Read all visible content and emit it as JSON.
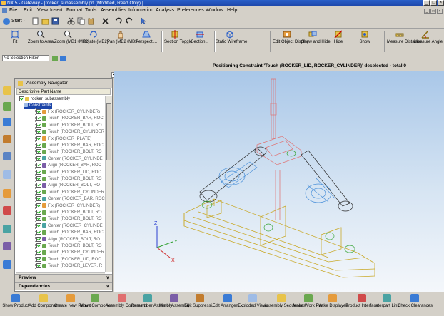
{
  "window": {
    "title": "NX 5 - Gateway - [rocker_subassembly.prt (Modified, Read Only) ]"
  },
  "menu": [
    "File",
    "Edit",
    "View",
    "Insert",
    "Format",
    "Tools",
    "Assemblies",
    "Information",
    "Analysis",
    "Preferences",
    "Window",
    "Help"
  ],
  "start_label": "Start ·",
  "toolbar": [
    "Fit",
    "Zoom to Area",
    "Zoom (MB1+MB2)",
    "Rotate (MB2)",
    "Pan (MB2+MB3)",
    "Perspecti...",
    "Section Toggle",
    "Section...",
    "Static Wireframe",
    "Edit Object Display",
    "Show and Hide",
    "Hide",
    "Show",
    "Measure Distance",
    "Measure Angle"
  ],
  "selection_filter": "No Selection Filter",
  "status_message": "Positioning Constraint 'Touch (ROCKER_LID, ROCKER_CYLINDER)' deselected - total 0",
  "navigator": {
    "title": "Assembly Navigator",
    "column": "Descriptive Part Name",
    "root": "rocker_subassembly",
    "constraints_folder": "Constraints",
    "items": [
      "Fix (ROCKER_CYLINDER)",
      "Touch (ROCKER_BAR, ROC",
      "Touch (ROCKER_BOLT, RO",
      "Touch (ROCKER_CYLINDER",
      "Fix (ROCKER_PLATE)",
      "Touch (ROCKER_BAR, ROC",
      "Touch (ROCKER_BOLT, RO",
      "Center (ROCKER_CYLINDE",
      "Align (ROCKER_BAR, ROC",
      "Touch (ROCKER_LID, ROC",
      "Touch (ROCKER_BOLT, RO",
      "Align (ROCKER_BOLT, RO",
      "Touch (ROCKER_CYLINDER",
      "Center (ROCKER_BAR, ROC",
      "Fix (ROCKER_CYLINDER)",
      "Touch (ROCKER_BOLT, RO",
      "Touch (ROCKER_BOLT, RO",
      "Center (ROCKER_CYLINDE",
      "Touch (ROCKER_BAR, ROC",
      "Align (ROCKER_BOLT, RO",
      "Touch (ROCKER_BOLT, RO",
      "Touch (ROCKER_CYLINDER",
      "Touch (ROCKER_LID, ROC",
      "Touch (ROCKER_LEVER, R"
    ],
    "panels": [
      "Preview",
      "Dependencies"
    ]
  },
  "bottom_toolbar": [
    "Show Product",
    "Add Component",
    "Create New Parent",
    "Move Component",
    "Assembly Constraints",
    "Remember Assembly",
    "Mirror Assembly",
    "Edit Suppressi...",
    "Edit Arrangem...",
    "Exploded Views",
    "Assembly Sequences",
    "Make Work Part",
    "Make Displayed",
    "Product Interface",
    "Interpart Link",
    "Check Clearances"
  ],
  "axes": {
    "z": "Z",
    "y": "Y",
    "x": "X"
  }
}
